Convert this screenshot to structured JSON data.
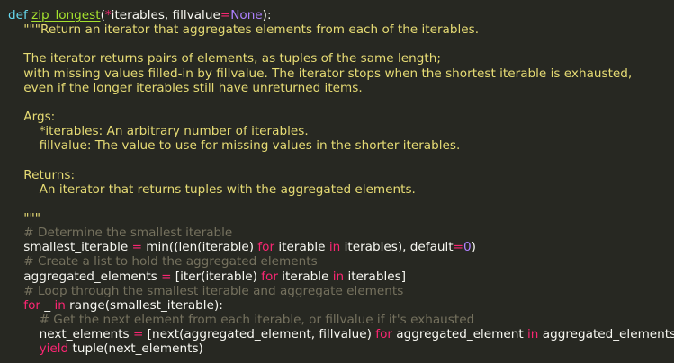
{
  "editor": {
    "theme_colors": {
      "background": "#272822",
      "text": "#f8f8f2",
      "keyword": "#66d9ef",
      "control": "#f92672",
      "function": "#a6e22e",
      "number": "#ae81ff",
      "string": "#e6db74",
      "comment": "#75715e"
    },
    "lines": [
      {
        "indent": "",
        "tokens": [
          {
            "t": "def",
            "c": "kw"
          },
          {
            "t": " ",
            "c": "plain"
          },
          {
            "t": "zip_longest",
            "c": "fn"
          },
          {
            "t": "(",
            "c": "plain"
          },
          {
            "t": "*",
            "c": "op"
          },
          {
            "t": "iterables, fillvalue",
            "c": "plain"
          },
          {
            "t": "=",
            "c": "op"
          },
          {
            "t": "None",
            "c": "num"
          },
          {
            "t": "):",
            "c": "plain"
          }
        ]
      },
      {
        "indent": "    ",
        "tokens": [
          {
            "t": "\"\"\"Return an iterator that aggregates elements from each of the iterables.",
            "c": "str"
          }
        ]
      },
      {
        "indent": "",
        "tokens": []
      },
      {
        "indent": "    ",
        "tokens": [
          {
            "t": "The iterator returns pairs of elements, as tuples of the same length;",
            "c": "str"
          }
        ]
      },
      {
        "indent": "    ",
        "tokens": [
          {
            "t": "with missing values filled-in by fillvalue. The iterator stops when the shortest iterable is exhausted,",
            "c": "str"
          }
        ]
      },
      {
        "indent": "    ",
        "tokens": [
          {
            "t": "even if the longer iterables still have unreturned items.",
            "c": "str"
          }
        ]
      },
      {
        "indent": "",
        "tokens": []
      },
      {
        "indent": "    ",
        "tokens": [
          {
            "t": "Args:",
            "c": "str"
          }
        ]
      },
      {
        "indent": "        ",
        "tokens": [
          {
            "t": "*iterables: An arbitrary number of iterables.",
            "c": "str"
          }
        ]
      },
      {
        "indent": "        ",
        "tokens": [
          {
            "t": "fillvalue: The value to use for missing values in the shorter iterables.",
            "c": "str"
          }
        ]
      },
      {
        "indent": "",
        "tokens": []
      },
      {
        "indent": "    ",
        "tokens": [
          {
            "t": "Returns:",
            "c": "str"
          }
        ]
      },
      {
        "indent": "        ",
        "tokens": [
          {
            "t": "An iterator that returns tuples with the aggregated elements.",
            "c": "str"
          }
        ]
      },
      {
        "indent": "",
        "tokens": []
      },
      {
        "indent": "    ",
        "tokens": [
          {
            "t": "\"\"\"",
            "c": "str"
          }
        ]
      },
      {
        "indent": "    ",
        "tokens": [
          {
            "t": "# Determine the smallest iterable",
            "c": "cmt"
          }
        ]
      },
      {
        "indent": "    ",
        "tokens": [
          {
            "t": "smallest_iterable ",
            "c": "plain"
          },
          {
            "t": "=",
            "c": "op"
          },
          {
            "t": " min((len(iterable) ",
            "c": "plain"
          },
          {
            "t": "for",
            "c": "ctl"
          },
          {
            "t": " iterable ",
            "c": "plain"
          },
          {
            "t": "in",
            "c": "ctl"
          },
          {
            "t": " iterables), default",
            "c": "plain"
          },
          {
            "t": "=",
            "c": "op"
          },
          {
            "t": "0",
            "c": "num"
          },
          {
            "t": ")",
            "c": "plain"
          }
        ]
      },
      {
        "indent": "    ",
        "tokens": [
          {
            "t": "# Create a list to hold the aggregated elements",
            "c": "cmt"
          }
        ]
      },
      {
        "indent": "    ",
        "tokens": [
          {
            "t": "aggregated_elements ",
            "c": "plain"
          },
          {
            "t": "=",
            "c": "op"
          },
          {
            "t": " [iter(iterable) ",
            "c": "plain"
          },
          {
            "t": "for",
            "c": "ctl"
          },
          {
            "t": " iterable ",
            "c": "plain"
          },
          {
            "t": "in",
            "c": "ctl"
          },
          {
            "t": " iterables]",
            "c": "plain"
          }
        ]
      },
      {
        "indent": "    ",
        "tokens": [
          {
            "t": "# Loop through the smallest iterable and aggregate elements",
            "c": "cmt"
          }
        ]
      },
      {
        "indent": "    ",
        "tokens": [
          {
            "t": "for",
            "c": "ctl"
          },
          {
            "t": " _ ",
            "c": "plain"
          },
          {
            "t": "in",
            "c": "ctl"
          },
          {
            "t": " range(smallest_iterable):",
            "c": "plain"
          }
        ]
      },
      {
        "indent": "        ",
        "tokens": [
          {
            "t": "# Get the next element from each iterable, or fillvalue if it's exhausted",
            "c": "cmt"
          }
        ]
      },
      {
        "indent": "        ",
        "tokens": [
          {
            "t": "next_elements ",
            "c": "plain"
          },
          {
            "t": "=",
            "c": "op"
          },
          {
            "t": " [next(aggregated_element, fillvalue) ",
            "c": "plain"
          },
          {
            "t": "for",
            "c": "ctl"
          },
          {
            "t": " aggregated_element ",
            "c": "plain"
          },
          {
            "t": "in",
            "c": "ctl"
          },
          {
            "t": " aggregated_elements]",
            "c": "plain"
          }
        ]
      },
      {
        "indent": "        ",
        "tokens": [
          {
            "t": "yield",
            "c": "ctl"
          },
          {
            "t": " tuple(next_elements)",
            "c": "plain"
          }
        ]
      }
    ]
  }
}
